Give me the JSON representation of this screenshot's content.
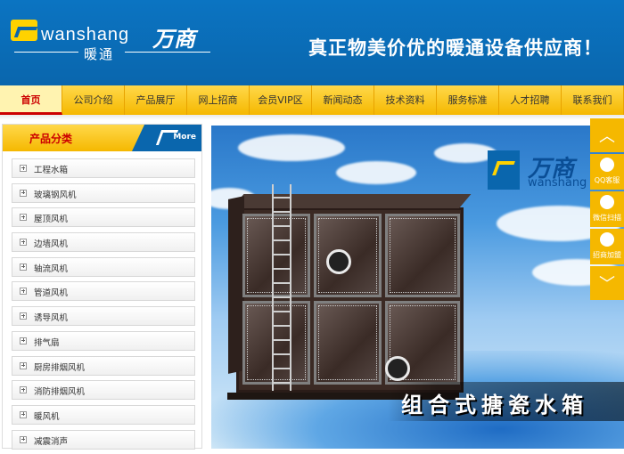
{
  "header": {
    "logo_en": "wanshang",
    "logo_cn": "万商",
    "logo_sub": "暖通",
    "slogan": "真正物美价优的暖通设备供应商！"
  },
  "nav": {
    "items": [
      {
        "label": "首页"
      },
      {
        "label": "公司介绍"
      },
      {
        "label": "产品展厅"
      },
      {
        "label": "网上招商"
      },
      {
        "label": "会员VIP区"
      },
      {
        "label": "新闻动态"
      },
      {
        "label": "技术资料"
      },
      {
        "label": "服务标准"
      },
      {
        "label": "人才招聘"
      },
      {
        "label": "联系我们"
      }
    ]
  },
  "sidebar": {
    "title": "产品分类",
    "more": "More",
    "items": [
      {
        "label": "工程水箱"
      },
      {
        "label": "玻璃钢风机"
      },
      {
        "label": "屋顶风机"
      },
      {
        "label": "边墙风机"
      },
      {
        "label": "轴流风机"
      },
      {
        "label": "管道风机"
      },
      {
        "label": "诱导风机"
      },
      {
        "label": "排气扇"
      },
      {
        "label": "厨房排烟风机"
      },
      {
        "label": "消防排烟风机"
      },
      {
        "label": "暖风机"
      },
      {
        "label": "减震消声"
      }
    ]
  },
  "banner": {
    "logo_cn": "万商",
    "logo_en": "wanshang",
    "caption": "组合式搪瓷水箱"
  },
  "float_tool": {
    "items": [
      {
        "label": "QQ客服",
        "icon": "qq-icon"
      },
      {
        "label": "微信扫描",
        "icon": "wechat-icon"
      },
      {
        "label": "招商加盟",
        "icon": "chat-icon"
      }
    ]
  },
  "colors": {
    "brand_blue": "#0a66ad",
    "nav_yellow": "#f5b800",
    "active_red": "#cc0000"
  }
}
